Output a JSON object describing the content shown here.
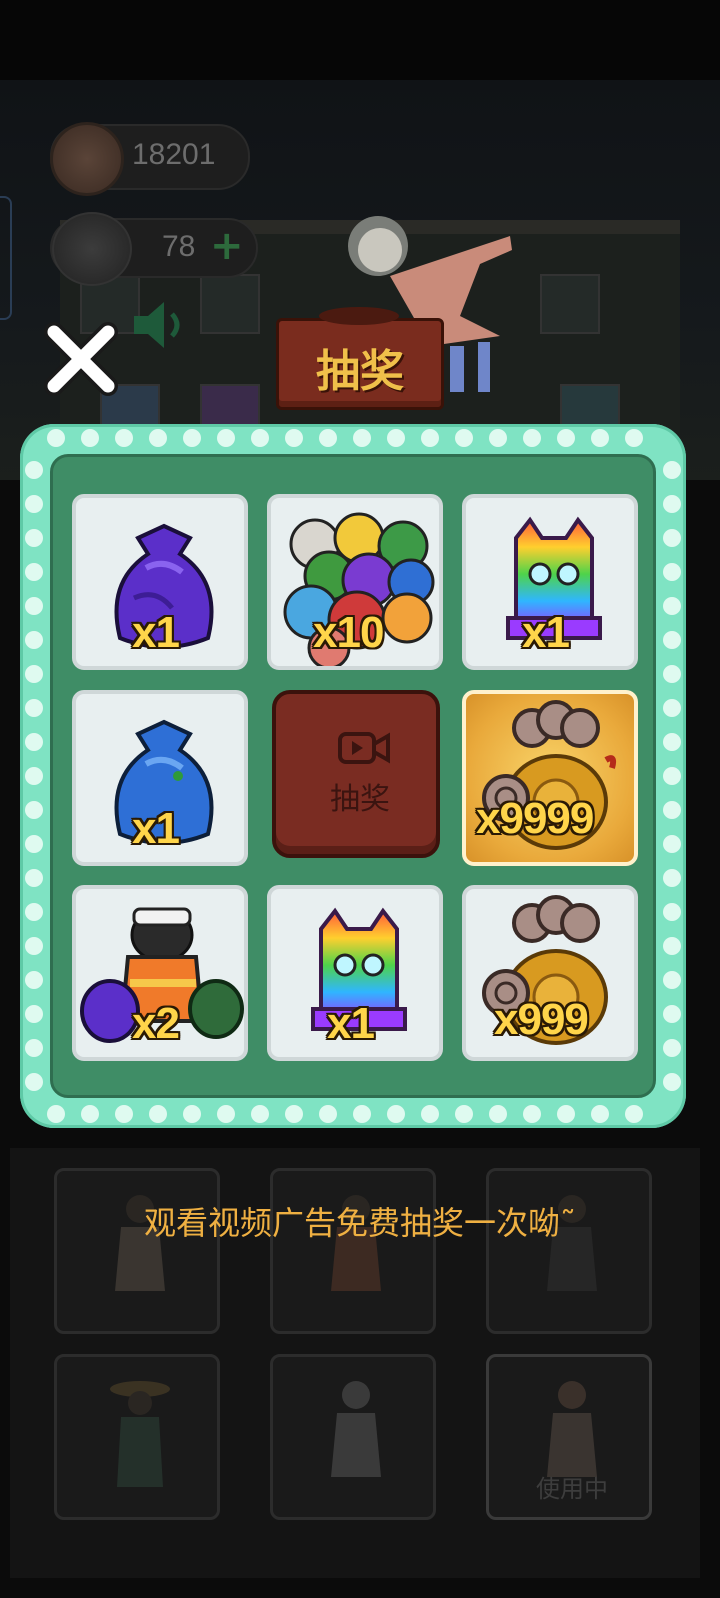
{
  "hud": {
    "coins": "18201",
    "energy": "78",
    "energy_plus": "+"
  },
  "dialog": {
    "title": "抽奖",
    "draw_button_label": "抽奖",
    "close_icon": "close-icon",
    "hint": "观看视频广告免费抽奖一次呦˜"
  },
  "prizes": [
    {
      "name": "purple-trash-bag",
      "qty": "x1"
    },
    {
      "name": "mixed-trash-bags",
      "qty": "x10"
    },
    {
      "name": "rainbow-cat-box",
      "qty": "x1"
    },
    {
      "name": "blue-trash-bag",
      "qty": "x1"
    },
    {
      "name": "coin-bag-large",
      "qty": "x9999",
      "highlighted": true
    },
    {
      "name": "worker-with-bags",
      "qty": "x2"
    },
    {
      "name": "rainbow-cat-box",
      "qty": "x1"
    },
    {
      "name": "coin-bag-small",
      "qty": "x999"
    }
  ],
  "outfits": {
    "in_use_label": "使用中"
  },
  "colors": {
    "panel_border": "#7fe3c3",
    "panel_inner": "#3f8d66",
    "draw_button": "#7a2c22",
    "quantity_text": "#ffd54a",
    "hint_text": "#efb042"
  }
}
